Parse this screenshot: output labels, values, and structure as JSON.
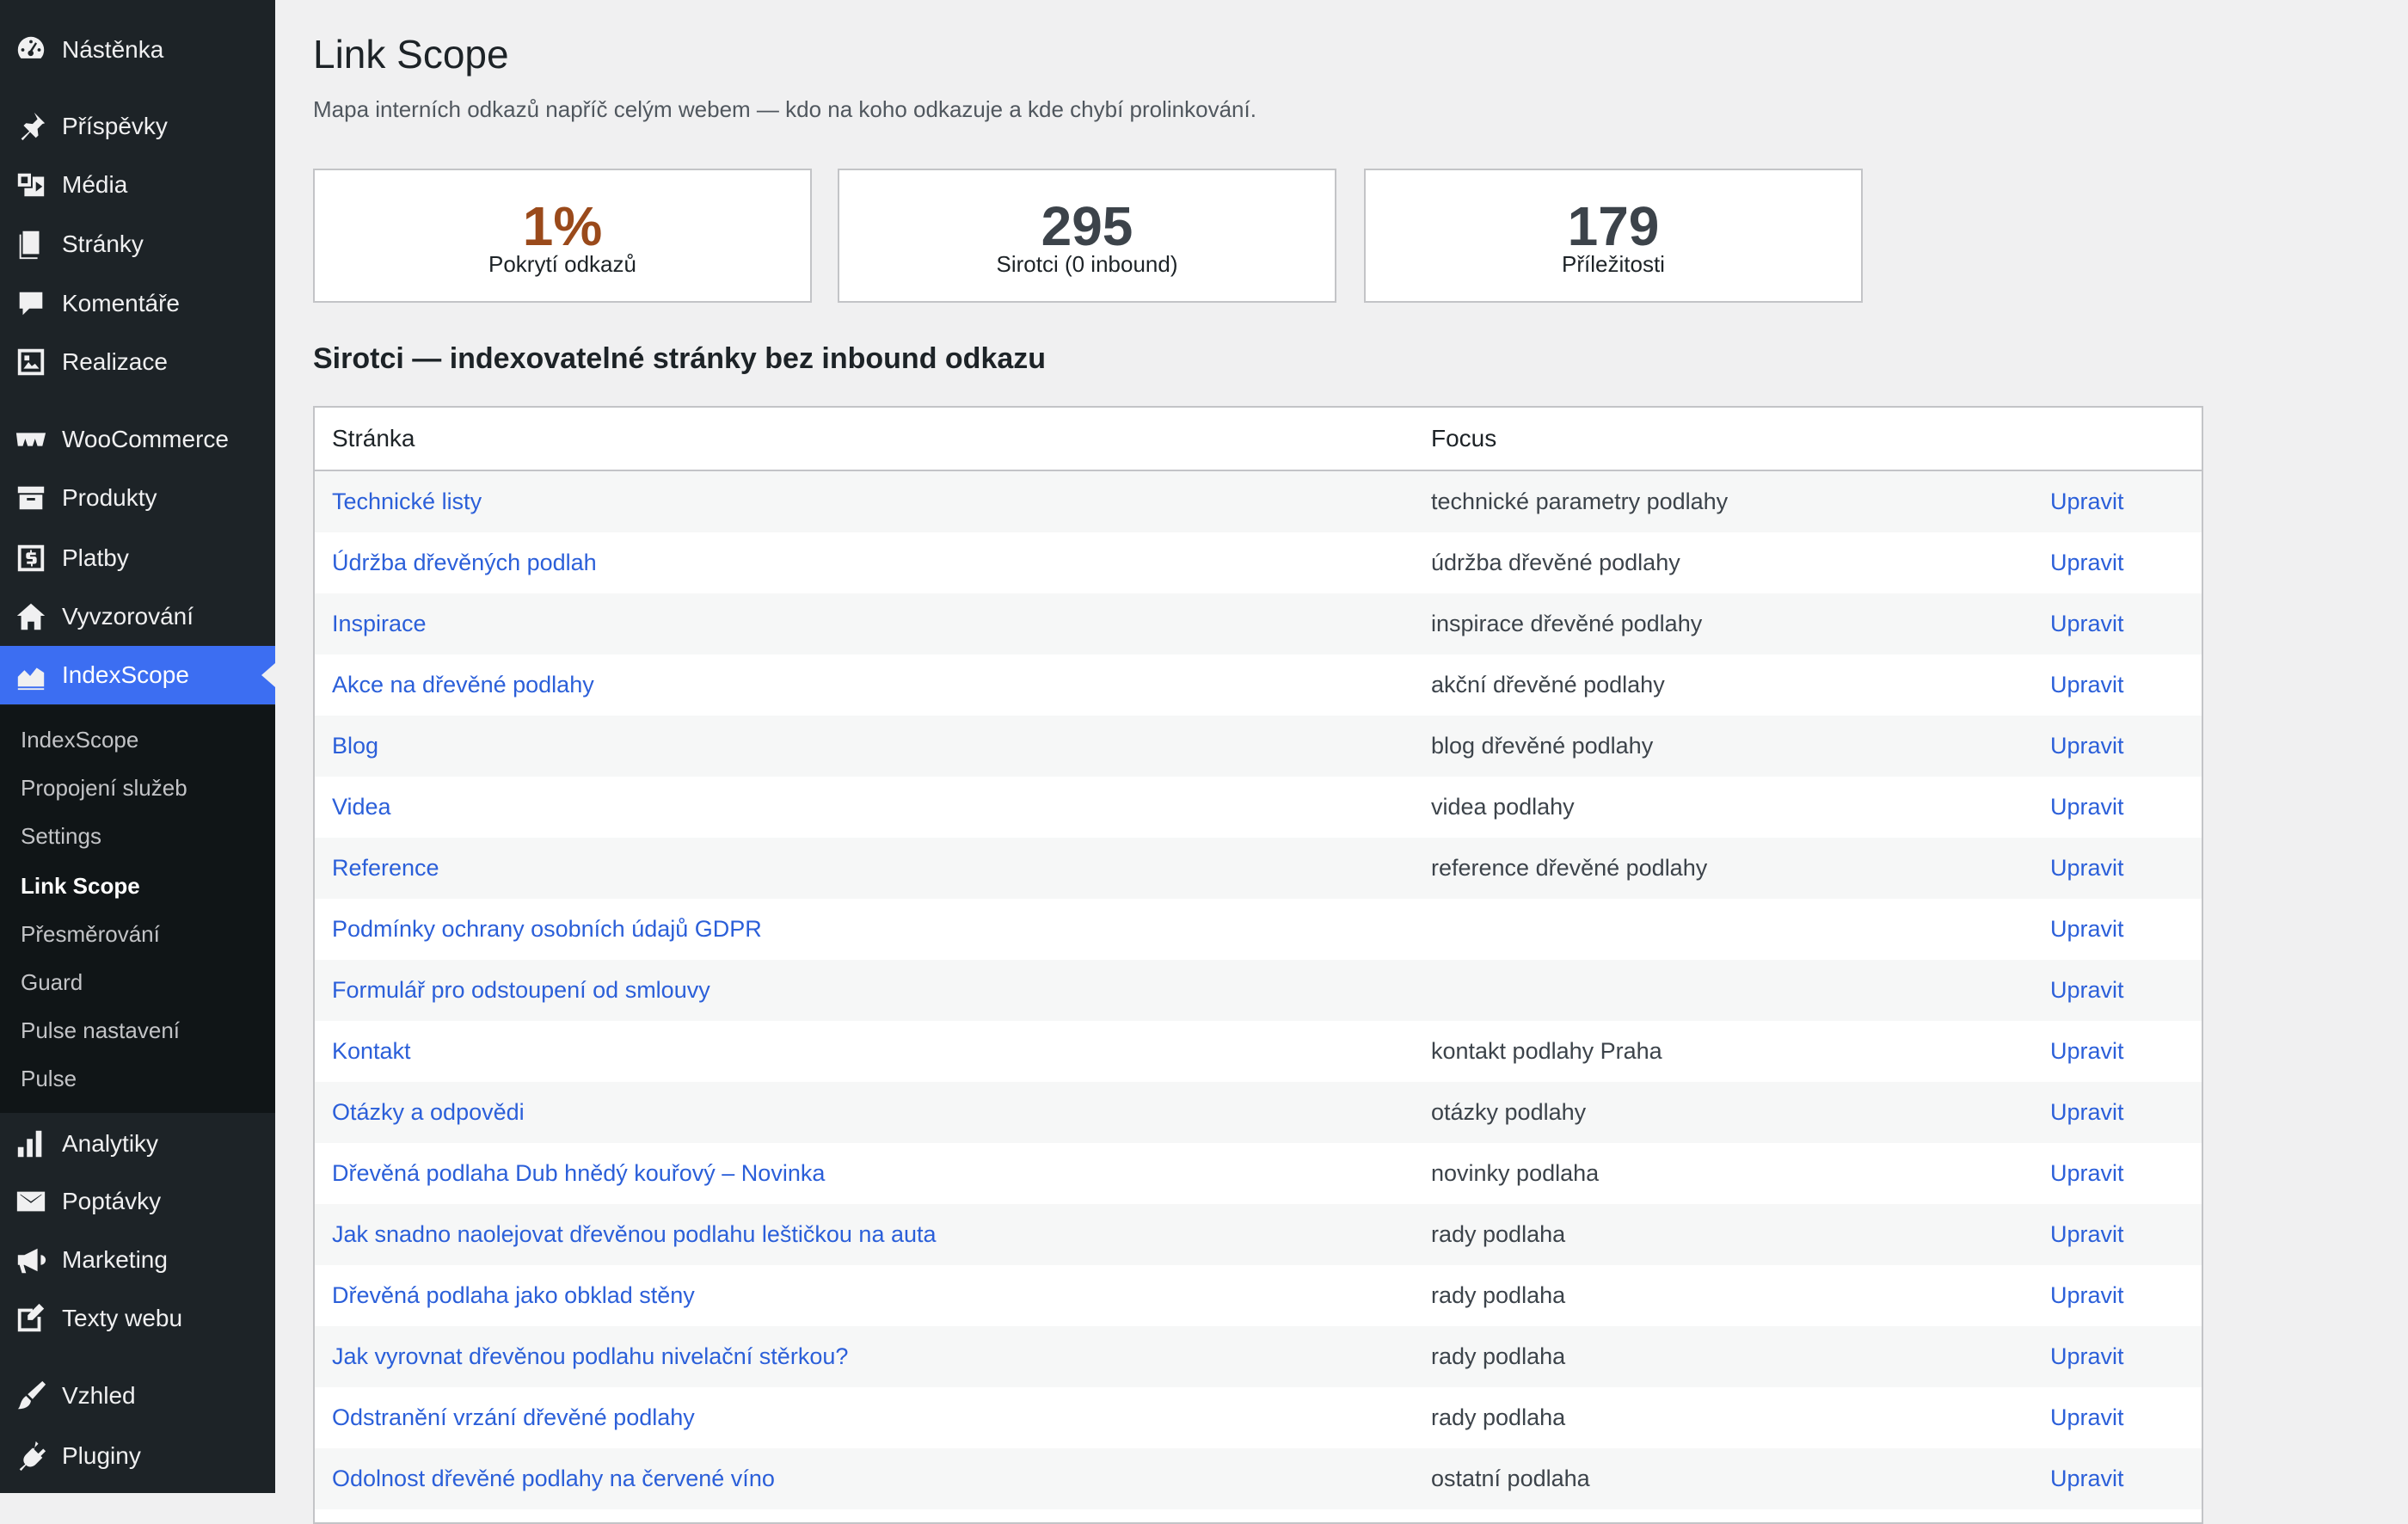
{
  "sidebar": {
    "top_items": [
      {
        "label": "Nástěnka",
        "icon": "dashboard-icon"
      },
      {
        "label": "Příspěvky",
        "icon": "pin-icon"
      },
      {
        "label": "Média",
        "icon": "media-icon"
      },
      {
        "label": "Stránky",
        "icon": "pages-icon"
      },
      {
        "label": "Komentáře",
        "icon": "comment-icon"
      },
      {
        "label": "Realizace",
        "icon": "gallery-icon"
      },
      {
        "label": "WooCommerce",
        "icon": "woocommerce-icon"
      },
      {
        "label": "Produkty",
        "icon": "archive-icon"
      },
      {
        "label": "Platby",
        "icon": "dollar-icon"
      },
      {
        "label": "Vyvzorování",
        "icon": "home-icon"
      },
      {
        "label": "IndexScope",
        "icon": "chart-area-icon",
        "active": true
      }
    ],
    "submenu": [
      {
        "label": "IndexScope"
      },
      {
        "label": "Propojení služeb"
      },
      {
        "label": "Settings"
      },
      {
        "label": "Link Scope",
        "current": true
      },
      {
        "label": "Přesměrování"
      },
      {
        "label": "Guard"
      },
      {
        "label": "Pulse nastavení"
      },
      {
        "label": "Pulse"
      }
    ],
    "bottom_items": [
      {
        "label": "Analytiky",
        "icon": "bar-chart-icon"
      },
      {
        "label": "Poptávky",
        "icon": "mail-icon"
      },
      {
        "label": "Marketing",
        "icon": "megaphone-icon"
      },
      {
        "label": "Texty webu",
        "icon": "edit-icon"
      },
      {
        "label": "Vzhled",
        "icon": "brush-icon"
      },
      {
        "label": "Pluginy",
        "icon": "plugin-icon"
      }
    ]
  },
  "page": {
    "title": "Link Scope",
    "description": "Mapa interních odkazů napříč celým webem — kdo na koho odkazuje a kde chybí prolinkování."
  },
  "stats": [
    {
      "value": "1%",
      "label": "Pokrytí odkazů",
      "color": "#9a4a1b"
    },
    {
      "value": "295",
      "label": "Sirotci (0 inbound)",
      "color": "#3c434a"
    },
    {
      "value": "179",
      "label": "Příležitosti",
      "color": "#3c434a"
    }
  ],
  "section": {
    "title": "Sirotci — indexovatelné stránky bez inbound odkazu"
  },
  "table": {
    "columns": [
      "Stránka",
      "Focus",
      ""
    ],
    "rows": [
      {
        "page": "Technické listy",
        "focus": "technické parametry podlahy",
        "action": "Upravit"
      },
      {
        "page": "Údržba dřevěných podlah",
        "focus": "údržba dřevěné podlahy",
        "action": "Upravit"
      },
      {
        "page": "Inspirace",
        "focus": "inspirace dřevěné podlahy",
        "action": "Upravit"
      },
      {
        "page": "Akce na dřevěné podlahy",
        "focus": "akční dřevěné podlahy",
        "action": "Upravit"
      },
      {
        "page": "Blog",
        "focus": "blog dřevěné podlahy",
        "action": "Upravit"
      },
      {
        "page": "Videa",
        "focus": "videa podlahy",
        "action": "Upravit"
      },
      {
        "page": "Reference",
        "focus": "reference dřevěné podlahy",
        "action": "Upravit"
      },
      {
        "page": "Podmínky ochrany osobních údajů GDPR",
        "focus": "",
        "action": "Upravit"
      },
      {
        "page": "Formulář pro odstoupení od smlouvy",
        "focus": "",
        "action": "Upravit"
      },
      {
        "page": "Kontakt",
        "focus": "kontakt podlahy Praha",
        "action": "Upravit"
      },
      {
        "page": "Otázky a odpovědi",
        "focus": "otázky podlahy",
        "action": "Upravit"
      },
      {
        "page": "Dřevěná podlaha Dub hnědý kouřový – Novinka",
        "focus": "novinky podlaha",
        "action": "Upravit"
      },
      {
        "page": "Jak snadno naolejovat dřevěnou podlahu leštičkou na auta",
        "focus": "rady podlaha",
        "action": "Upravit"
      },
      {
        "page": "Dřevěná podlaha jako obklad stěny",
        "focus": "rady podlaha",
        "action": "Upravit"
      },
      {
        "page": "Jak vyrovnat dřevěnou podlahu nivelační stěrkou?",
        "focus": "rady podlaha",
        "action": "Upravit"
      },
      {
        "page": "Odstranění vrzání dřevěné podlahy",
        "focus": "rady podlaha",
        "action": "Upravit"
      },
      {
        "page": "Odolnost dřevěné podlahy na červené víno",
        "focus": "ostatní podlaha",
        "action": "Upravit"
      }
    ]
  }
}
